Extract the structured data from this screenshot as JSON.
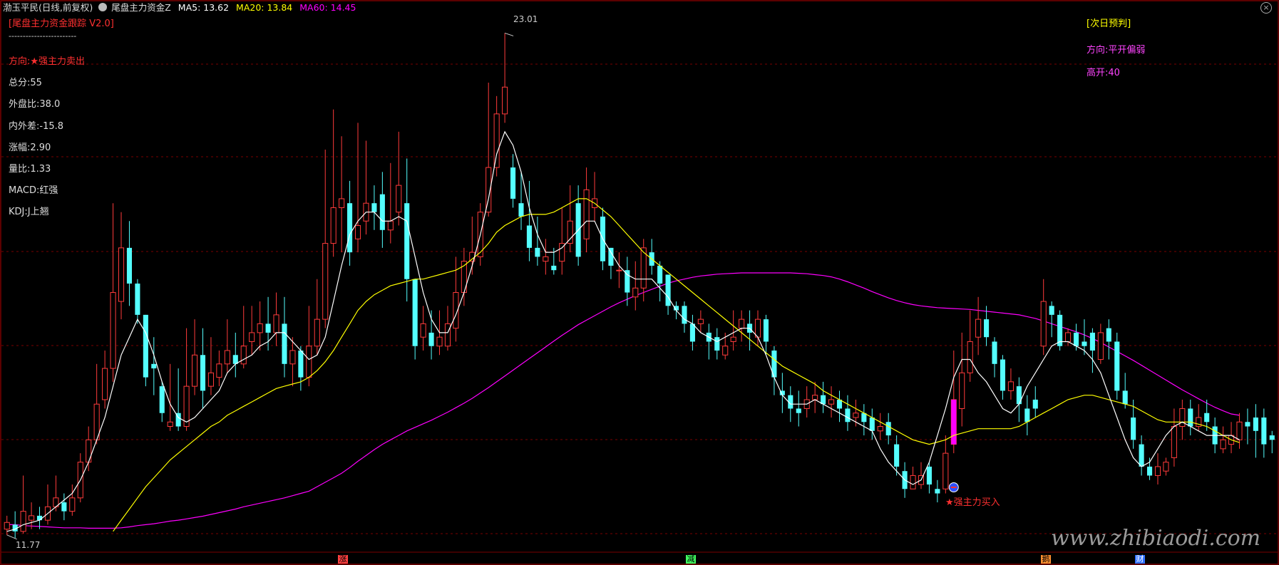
{
  "header": {
    "stock_name": "渤玉平民(日线,前复权)",
    "indicator_name": "尾盘主力资金Z",
    "ma5": "MA5: 13.62",
    "ma20": "MA20: 13.84",
    "ma60": "MA60: 14.45"
  },
  "left_panel": {
    "title": "[尾盘主力资金跟踪 V2.0]",
    "divider": "------------------------",
    "direction": "方向:★强主力卖出",
    "total_score": "总分:55",
    "outer_ratio": "外盘比:38.0",
    "inner_outer_diff": "内外差:-15.8",
    "change": "涨幅:2.90",
    "volume_ratio": "量比:1.33",
    "macd": "MACD:红强",
    "kdj": "KDJ:J上翘"
  },
  "right_panel": {
    "title": "[次日预判]",
    "direction": "方向:平开偏弱",
    "gap": "高开:40"
  },
  "annotations": {
    "high_label": "23.01",
    "low_label": "11.77",
    "buy_signal": "★强主力买入",
    "watermark": "www.zhibiaodi.com"
  },
  "bottom_markers": [
    "涨",
    "减",
    "鹅",
    "财"
  ],
  "colors": {
    "background": "#000000",
    "up": "#ff3b3b",
    "down": "#54ffff",
    "ma5": "#ffffff",
    "ma20": "#ffff00",
    "ma60": "#ff00ff",
    "grid": "#7a0000",
    "signal_bar": "#ff00ff"
  },
  "chart_data": {
    "type": "candlestick",
    "ylim": [
      11.4,
      23.4
    ],
    "grid": true,
    "series_names": [
      "MA5",
      "MA20",
      "MA60"
    ],
    "candles": [
      [
        11.9,
        12.05,
        11.77,
        12.2
      ],
      [
        12.0,
        11.85,
        11.7,
        12.3
      ],
      [
        11.85,
        12.3,
        11.8,
        13.1
      ],
      [
        12.1,
        12.2,
        11.9,
        12.5
      ],
      [
        12.2,
        12.1,
        11.9,
        12.4
      ],
      [
        12.1,
        12.4,
        12.0,
        12.9
      ],
      [
        12.4,
        12.6,
        12.3,
        13.1
      ],
      [
        12.5,
        12.3,
        12.1,
        12.7
      ],
      [
        12.3,
        12.6,
        12.2,
        12.9
      ],
      [
        12.6,
        13.4,
        12.5,
        13.6
      ],
      [
        13.4,
        13.9,
        13.2,
        14.2
      ],
      [
        13.9,
        14.7,
        13.8,
        15.6
      ],
      [
        14.8,
        15.5,
        14.6,
        15.9
      ],
      [
        15.5,
        17.2,
        15.2,
        19.2
      ],
      [
        17.0,
        18.2,
        16.6,
        19.0
      ],
      [
        18.2,
        17.4,
        16.9,
        18.8
      ],
      [
        17.4,
        16.7,
        16.5,
        17.5
      ],
      [
        16.7,
        15.3,
        15.1,
        16.7
      ],
      [
        15.6,
        15.5,
        14.9,
        16.2
      ],
      [
        15.1,
        14.5,
        14.3,
        15.2
      ],
      [
        14.2,
        14.3,
        14.1,
        15.6
      ],
      [
        14.5,
        14.2,
        14.1,
        15.5
      ],
      [
        14.2,
        15.1,
        14.1,
        16.4
      ],
      [
        15.1,
        15.8,
        14.9,
        16.6
      ],
      [
        15.8,
        15.0,
        14.6,
        16.4
      ],
      [
        15.1,
        15.4,
        14.9,
        16.2
      ],
      [
        15.3,
        15.6,
        15.1,
        15.9
      ],
      [
        15.6,
        15.9,
        15.4,
        16.6
      ],
      [
        15.8,
        15.6,
        15.3,
        16.3
      ],
      [
        15.6,
        16.0,
        15.5,
        16.9
      ],
      [
        16.1,
        16.3,
        15.8,
        16.9
      ],
      [
        16.3,
        16.5,
        15.9,
        17.0
      ],
      [
        16.5,
        16.3,
        15.9,
        17.1
      ],
      [
        16.3,
        16.7,
        16.0,
        17.2
      ],
      [
        16.5,
        15.6,
        15.3,
        17.1
      ],
      [
        15.6,
        15.9,
        15.1,
        16.2
      ],
      [
        15.9,
        15.3,
        15.0,
        16.0
      ],
      [
        15.3,
        16.0,
        15.1,
        16.9
      ],
      [
        16.0,
        16.6,
        15.8,
        17.5
      ],
      [
        16.6,
        18.3,
        16.4,
        20.4
      ],
      [
        18.3,
        19.1,
        18.0,
        21.3
      ],
      [
        19.1,
        19.3,
        18.1,
        20.7
      ],
      [
        19.2,
        18.1,
        17.8,
        19.7
      ],
      [
        18.4,
        18.7,
        18.1,
        21.0
      ],
      [
        18.8,
        19.2,
        18.5,
        20.6
      ],
      [
        19.2,
        19.0,
        18.6,
        19.6
      ],
      [
        19.4,
        18.6,
        18.2,
        19.9
      ],
      [
        18.6,
        18.8,
        18.3,
        20.1
      ],
      [
        19.0,
        19.6,
        18.7,
        20.8
      ],
      [
        19.2,
        17.5,
        17.0,
        20.2
      ],
      [
        17.5,
        16.0,
        15.7,
        17.5
      ],
      [
        16.2,
        16.5,
        15.9,
        16.9
      ],
      [
        16.3,
        16.0,
        15.7,
        16.8
      ],
      [
        16.0,
        16.2,
        15.8,
        16.8
      ],
      [
        16.0,
        16.5,
        15.9,
        16.9
      ],
      [
        16.4,
        17.2,
        16.1,
        18.0
      ],
      [
        17.2,
        17.9,
        16.9,
        18.2
      ],
      [
        17.9,
        18.1,
        17.6,
        18.9
      ],
      [
        18.0,
        19.0,
        17.8,
        19.2
      ],
      [
        19.0,
        20.0,
        18.9,
        21.9
      ],
      [
        20.0,
        21.2,
        19.8,
        21.6
      ],
      [
        21.2,
        21.8,
        21.0,
        23.01
      ],
      [
        20.0,
        19.3,
        19.1,
        20.3
      ],
      [
        19.2,
        18.9,
        18.6,
        19.9
      ],
      [
        18.7,
        18.2,
        17.9,
        19.7
      ],
      [
        18.2,
        18.0,
        17.8,
        18.9
      ],
      [
        17.9,
        18.0,
        17.6,
        18.4
      ],
      [
        17.8,
        17.7,
        17.6,
        18.2
      ],
      [
        17.9,
        18.3,
        17.6,
        19.1
      ],
      [
        18.3,
        18.8,
        18.1,
        19.6
      ],
      [
        19.2,
        18.0,
        17.8,
        19.6
      ],
      [
        18.4,
        19.5,
        18.1,
        20.0
      ],
      [
        19.1,
        19.3,
        18.8,
        19.9
      ],
      [
        18.9,
        17.9,
        17.7,
        19.1
      ],
      [
        18.2,
        17.8,
        17.5,
        18.2
      ],
      [
        17.7,
        17.7,
        17.3,
        18.1
      ],
      [
        17.7,
        17.2,
        16.9,
        18.0
      ],
      [
        17.1,
        17.3,
        16.8,
        17.9
      ],
      [
        17.3,
        18.2,
        17.0,
        18.4
      ],
      [
        18.1,
        17.8,
        17.6,
        18.4
      ],
      [
        17.8,
        17.4,
        17.0,
        17.9
      ],
      [
        17.6,
        16.9,
        16.7,
        17.6
      ],
      [
        16.9,
        16.8,
        16.6,
        17.0
      ],
      [
        16.9,
        16.5,
        16.3,
        17.0
      ],
      [
        16.5,
        16.1,
        15.9,
        16.7
      ],
      [
        16.5,
        16.6,
        16.3,
        16.8
      ],
      [
        16.3,
        16.1,
        15.7,
        16.5
      ],
      [
        16.2,
        15.9,
        15.7,
        16.4
      ],
      [
        15.8,
        16.0,
        15.7,
        16.3
      ],
      [
        16.1,
        16.2,
        15.9,
        16.8
      ],
      [
        16.4,
        16.6,
        16.1,
        16.8
      ],
      [
        16.5,
        16.3,
        15.9,
        16.8
      ],
      [
        16.2,
        16.6,
        16.0,
        16.8
      ],
      [
        16.6,
        16.1,
        15.8,
        16.7
      ],
      [
        15.9,
        15.3,
        14.9,
        16.0
      ],
      [
        15.0,
        14.9,
        14.5,
        15.4
      ],
      [
        14.9,
        14.6,
        14.3,
        15.1
      ],
      [
        14.6,
        14.5,
        14.2,
        15.0
      ],
      [
        14.6,
        14.8,
        14.4,
        15.1
      ],
      [
        14.8,
        14.9,
        14.5,
        15.2
      ],
      [
        14.9,
        14.7,
        14.5,
        15.2
      ],
      [
        14.7,
        14.8,
        14.4,
        15.1
      ],
      [
        14.8,
        14.6,
        14.3,
        15.0
      ],
      [
        14.6,
        14.3,
        14.1,
        14.9
      ],
      [
        14.4,
        14.5,
        14.2,
        14.8
      ],
      [
        14.5,
        14.3,
        14.0,
        14.7
      ],
      [
        14.4,
        14.1,
        13.9,
        14.6
      ],
      [
        14.1,
        14.2,
        13.9,
        14.5
      ],
      [
        14.3,
        14.0,
        13.8,
        14.5
      ],
      [
        13.8,
        13.3,
        13.1,
        14.0
      ],
      [
        13.2,
        12.8,
        12.6,
        13.4
      ],
      [
        12.8,
        13.1,
        12.8,
        13.3
      ],
      [
        12.9,
        13.1,
        12.8,
        13.4
      ],
      [
        13.3,
        12.9,
        12.7,
        13.4
      ],
      [
        12.8,
        12.7,
        12.5,
        13.0
      ],
      [
        12.8,
        13.6,
        12.7,
        14.0
      ],
      [
        13.8,
        14.8,
        13.6,
        15.9
      ],
      [
        14.6,
        15.4,
        14.2,
        16.3
      ],
      [
        15.4,
        16.1,
        15.2,
        16.8
      ],
      [
        16.2,
        16.6,
        15.8,
        17.1
      ],
      [
        16.6,
        16.2,
        16.0,
        16.9
      ],
      [
        16.1,
        15.6,
        15.3,
        16.2
      ],
      [
        15.7,
        15.0,
        14.8,
        15.8
      ],
      [
        15.0,
        15.2,
        14.8,
        15.5
      ],
      [
        15.1,
        14.7,
        14.3,
        15.3
      ],
      [
        14.6,
        14.3,
        14.0,
        14.9
      ],
      [
        14.8,
        14.6,
        14.4,
        15.1
      ],
      [
        16.0,
        17.0,
        15.8,
        17.5
      ],
      [
        16.9,
        16.7,
        16.2,
        17.0
      ],
      [
        16.7,
        16.0,
        15.9,
        16.8
      ],
      [
        16.1,
        16.3,
        16.0,
        16.4
      ],
      [
        16.3,
        16.0,
        15.9,
        16.5
      ],
      [
        16.1,
        16.0,
        15.8,
        16.6
      ],
      [
        16.3,
        15.9,
        15.4,
        16.4
      ],
      [
        15.7,
        16.3,
        15.6,
        16.5
      ],
      [
        16.4,
        16.1,
        15.7,
        16.6
      ],
      [
        16.1,
        15.0,
        14.8,
        16.3
      ],
      [
        15.0,
        14.7,
        14.6,
        15.4
      ],
      [
        14.4,
        13.9,
        13.7,
        14.8
      ],
      [
        13.8,
        13.3,
        13.1,
        14.0
      ],
      [
        13.3,
        13.1,
        13.0,
        13.5
      ],
      [
        13.1,
        13.3,
        12.9,
        13.6
      ],
      [
        13.2,
        13.4,
        13.1,
        13.5
      ],
      [
        13.5,
        14.2,
        13.3,
        14.6
      ],
      [
        14.2,
        14.6,
        13.9,
        14.8
      ],
      [
        14.6,
        14.2,
        14.0,
        14.8
      ],
      [
        14.2,
        14.4,
        14.1,
        14.7
      ],
      [
        14.5,
        14.3,
        14.1,
        14.8
      ],
      [
        14.2,
        13.8,
        13.6,
        14.4
      ],
      [
        13.7,
        13.9,
        13.6,
        14.2
      ],
      [
        13.8,
        14.0,
        13.6,
        14.3
      ],
      [
        13.9,
        14.3,
        13.7,
        14.5
      ],
      [
        14.3,
        14.2,
        13.8,
        14.6
      ],
      [
        14.4,
        14.1,
        13.5,
        14.7
      ],
      [
        14.4,
        13.8,
        13.5,
        14.6
      ],
      [
        14.0,
        13.9,
        13.6,
        14.1
      ]
    ],
    "ma5": [
      11.85,
      11.9,
      12.0,
      12.05,
      12.1,
      12.25,
      12.4,
      12.55,
      12.7,
      13.0,
      13.4,
      13.9,
      14.4,
      15.1,
      15.8,
      16.2,
      16.6,
      16.3,
      15.8,
      15.2,
      14.7,
      14.4,
      14.3,
      14.4,
      14.6,
      14.8,
      15.0,
      15.4,
      15.6,
      15.7,
      15.8,
      16.0,
      16.1,
      16.3,
      16.3,
      16.1,
      15.9,
      15.7,
      15.8,
      16.2,
      17.0,
      17.8,
      18.5,
      18.8,
      19.0,
      19.0,
      18.8,
      18.8,
      18.9,
      18.8,
      18.0,
      17.2,
      16.6,
      16.3,
      16.3,
      16.7,
      17.2,
      17.8,
      18.5,
      19.3,
      20.3,
      20.8,
      20.5,
      19.9,
      19.1,
      18.5,
      18.1,
      18.1,
      18.2,
      18.4,
      18.6,
      18.8,
      18.8,
      18.4,
      18.1,
      17.8,
      17.6,
      17.5,
      17.5,
      17.5,
      17.3,
      17.1,
      16.8,
      16.6,
      16.5,
      16.3,
      16.2,
      16.1,
      16.2,
      16.3,
      16.4,
      16.4,
      16.2,
      15.8,
      15.3,
      14.9,
      14.7,
      14.7,
      14.7,
      14.8,
      14.7,
      14.6,
      14.5,
      14.4,
      14.3,
      14.2,
      14.1,
      13.7,
      13.4,
      13.2,
      13.0,
      12.9,
      13.0,
      13.4,
      14.0,
      14.6,
      15.3,
      15.7,
      15.7,
      15.4,
      15.2,
      14.9,
      14.6,
      14.5,
      14.7,
      15.1,
      15.4,
      15.7,
      16.0,
      16.1,
      16.1,
      16.0,
      15.9,
      15.7,
      15.4,
      14.9,
      14.4,
      13.9,
      13.5,
      13.3,
      13.4,
      13.7,
      14.0,
      14.2,
      14.3,
      14.2,
      14.1,
      14.0,
      14.0,
      14.0,
      14.0,
      13.9
    ],
    "ma20": [
      null,
      null,
      null,
      null,
      null,
      null,
      null,
      null,
      null,
      null,
      null,
      null,
      null,
      11.85,
      12.1,
      12.35,
      12.6,
      12.85,
      13.05,
      13.25,
      13.45,
      13.6,
      13.75,
      13.9,
      14.05,
      14.2,
      14.3,
      14.45,
      14.55,
      14.65,
      14.75,
      14.85,
      14.95,
      15.05,
      15.1,
      15.15,
      15.2,
      15.3,
      15.45,
      15.65,
      15.9,
      16.2,
      16.5,
      16.8,
      17.0,
      17.15,
      17.25,
      17.35,
      17.4,
      17.45,
      17.5,
      17.5,
      17.55,
      17.6,
      17.65,
      17.7,
      17.8,
      17.95,
      18.1,
      18.3,
      18.55,
      18.7,
      18.8,
      18.9,
      18.95,
      18.95,
      18.95,
      19.0,
      19.1,
      19.2,
      19.3,
      19.3,
      19.2,
      19.05,
      18.9,
      18.7,
      18.5,
      18.3,
      18.1,
      17.95,
      17.8,
      17.65,
      17.5,
      17.35,
      17.2,
      17.05,
      16.9,
      16.75,
      16.6,
      16.45,
      16.3,
      16.15,
      16.0,
      15.85,
      15.7,
      15.55,
      15.45,
      15.35,
      15.25,
      15.15,
      15.0,
      14.9,
      14.8,
      14.7,
      14.6,
      14.5,
      14.4,
      14.3,
      14.2,
      14.1,
      14.0,
      13.9,
      13.85,
      13.8,
      13.85,
      13.9,
      14.0,
      14.05,
      14.1,
      14.15,
      14.15,
      14.15,
      14.15,
      14.15,
      14.2,
      14.3,
      14.4,
      14.5,
      14.6,
      14.7,
      14.8,
      14.85,
      14.9,
      14.9,
      14.85,
      14.8,
      14.75,
      14.7,
      14.65,
      14.55,
      14.45,
      14.35,
      14.3,
      14.3,
      14.3,
      14.3,
      14.25,
      14.2,
      14.1,
      14.0,
      13.9,
      13.84
    ],
    "ma60": [
      12.0,
      12.0,
      11.98,
      11.97,
      11.96,
      11.95,
      11.94,
      11.93,
      11.93,
      11.93,
      11.92,
      11.92,
      11.92,
      11.92,
      11.93,
      11.95,
      11.98,
      12.0,
      12.02,
      12.05,
      12.08,
      12.1,
      12.13,
      12.16,
      12.19,
      12.23,
      12.27,
      12.31,
      12.35,
      12.4,
      12.44,
      12.48,
      12.52,
      12.56,
      12.6,
      12.65,
      12.7,
      12.75,
      12.85,
      12.95,
      13.05,
      13.15,
      13.28,
      13.42,
      13.55,
      13.68,
      13.8,
      13.9,
      14.0,
      14.1,
      14.18,
      14.26,
      14.34,
      14.43,
      14.52,
      14.62,
      14.72,
      14.83,
      14.95,
      15.07,
      15.2,
      15.33,
      15.46,
      15.59,
      15.72,
      15.85,
      15.98,
      16.11,
      16.24,
      16.36,
      16.48,
      16.58,
      16.68,
      16.78,
      16.88,
      16.97,
      17.05,
      17.13,
      17.2,
      17.27,
      17.34,
      17.41,
      17.46,
      17.5,
      17.54,
      17.57,
      17.59,
      17.61,
      17.62,
      17.63,
      17.64,
      17.64,
      17.64,
      17.64,
      17.64,
      17.64,
      17.64,
      17.63,
      17.62,
      17.6,
      17.58,
      17.55,
      17.5,
      17.44,
      17.37,
      17.3,
      17.22,
      17.15,
      17.08,
      17.02,
      16.97,
      16.93,
      16.9,
      16.88,
      16.86,
      16.85,
      16.84,
      16.83,
      16.82,
      16.8,
      16.78,
      16.76,
      16.74,
      16.72,
      16.7,
      16.66,
      16.62,
      16.56,
      16.5,
      16.44,
      16.38,
      16.32,
      16.25,
      16.17,
      16.08,
      15.98,
      15.88,
      15.78,
      15.68,
      15.57,
      15.46,
      15.35,
      15.24,
      15.13,
      15.02,
      14.92,
      14.82,
      14.72,
      14.63,
      14.55,
      14.48,
      14.45
    ]
  }
}
